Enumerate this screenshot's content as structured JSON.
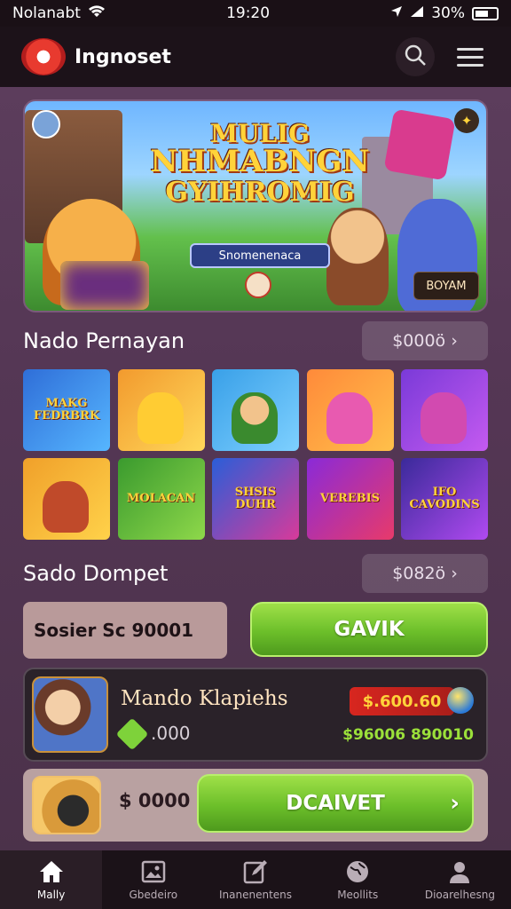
{
  "status_bar": {
    "carrier": "Nolanabt",
    "time": "19:20",
    "battery": "30%"
  },
  "header": {
    "app_title": "Ingnoset"
  },
  "banner": {
    "title_line1": "MULIG",
    "title_line2": "NHMABNGN",
    "title_line3": "GYIHROMIG",
    "pill_text": "Snomenenaca",
    "badge_text": "BOYAM"
  },
  "games_section": {
    "title": "Nado Pernayan",
    "pill_value": "$000ö"
  },
  "games": [
    {
      "label": "MAKG FEDRBRK",
      "bg": "linear-gradient(135deg,#2f6ed8,#56b6ff)"
    },
    {
      "label": "",
      "bg": "linear-gradient(135deg,#f29a2e,#ffd85a)"
    },
    {
      "label": "",
      "bg": "linear-gradient(135deg,#39a0e8,#7ed0ff)"
    },
    {
      "label": "",
      "bg": "linear-gradient(135deg,#ff8a3a,#ffc04a)"
    },
    {
      "label": "",
      "bg": "linear-gradient(135deg,#7a3ad8,#c45af0)"
    },
    {
      "label": "",
      "bg": "linear-gradient(135deg,#f0a02a,#ffd24a)"
    },
    {
      "label": "MOLACAN",
      "bg": "linear-gradient(135deg,#3a9a2e,#8ed84a)"
    },
    {
      "label": "SHSIS DUHR",
      "bg": "linear-gradient(135deg,#2a5ed8,#d83a9a)"
    },
    {
      "label": "VEREBIS",
      "bg": "linear-gradient(135deg,#8a2ad8,#e83a6a)"
    },
    {
      "label": "IFO CAVODINS",
      "bg": "linear-gradient(135deg,#3a2a9a,#b04af0)"
    }
  ],
  "wallet_section": {
    "title": "Sado Dompet",
    "pill_value": "$082ö",
    "amount_field": "Sosier Sc 90001",
    "action_label": "GAVIK"
  },
  "player_card": {
    "name": "Mando Klapiehs",
    "gem_value": ".000",
    "price": "$.600.60",
    "stats": "$96006 890010"
  },
  "deposit_card": {
    "amount": "$ 0000",
    "action_label": "DCAIVET"
  },
  "bottom_nav": [
    {
      "label": "Mally",
      "icon": "home-icon"
    },
    {
      "label": "Gbedeiro",
      "icon": "image-icon"
    },
    {
      "label": "Inanenentens",
      "icon": "edit-icon"
    },
    {
      "label": "Meollits",
      "icon": "globe-icon"
    },
    {
      "label": "Dioarelhesng",
      "icon": "user-icon"
    }
  ]
}
